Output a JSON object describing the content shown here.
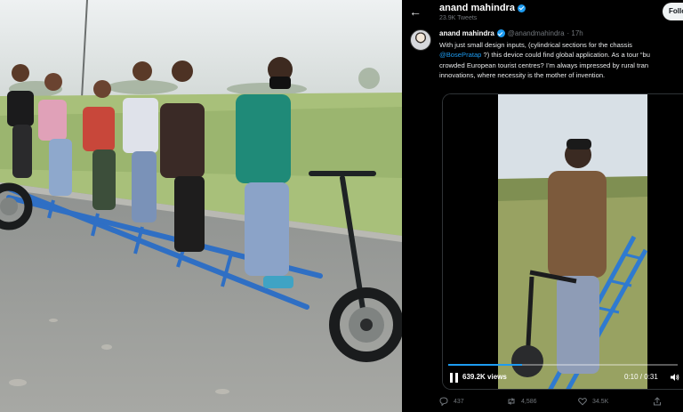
{
  "profile": {
    "name": "anand mahindra",
    "tweet_count": "23.9K Tweets",
    "follow_label": "Follow"
  },
  "tweet": {
    "author": "anand mahindra",
    "handle": "@anandmahindra",
    "time": "· 17h",
    "lines": [
      "With just small design inputs, (cylindrical sections for the chassis",
      "?) this device could find global application. As a tour “bu",
      "crowded European tourist centres? I’m always impressed by rural tran",
      "innovations, where necessity is the mother of invention."
    ],
    "mention": "@BosePratap"
  },
  "video": {
    "views": "639.2K views",
    "timecode": "0:10 / 0:31",
    "progress": 0.32
  },
  "actions": {
    "replies": "437",
    "retweets": "4,586",
    "likes": "34.5K"
  },
  "colors": {
    "accent": "#1d9bf0",
    "background": "#000000",
    "text_muted": "#71767b"
  }
}
